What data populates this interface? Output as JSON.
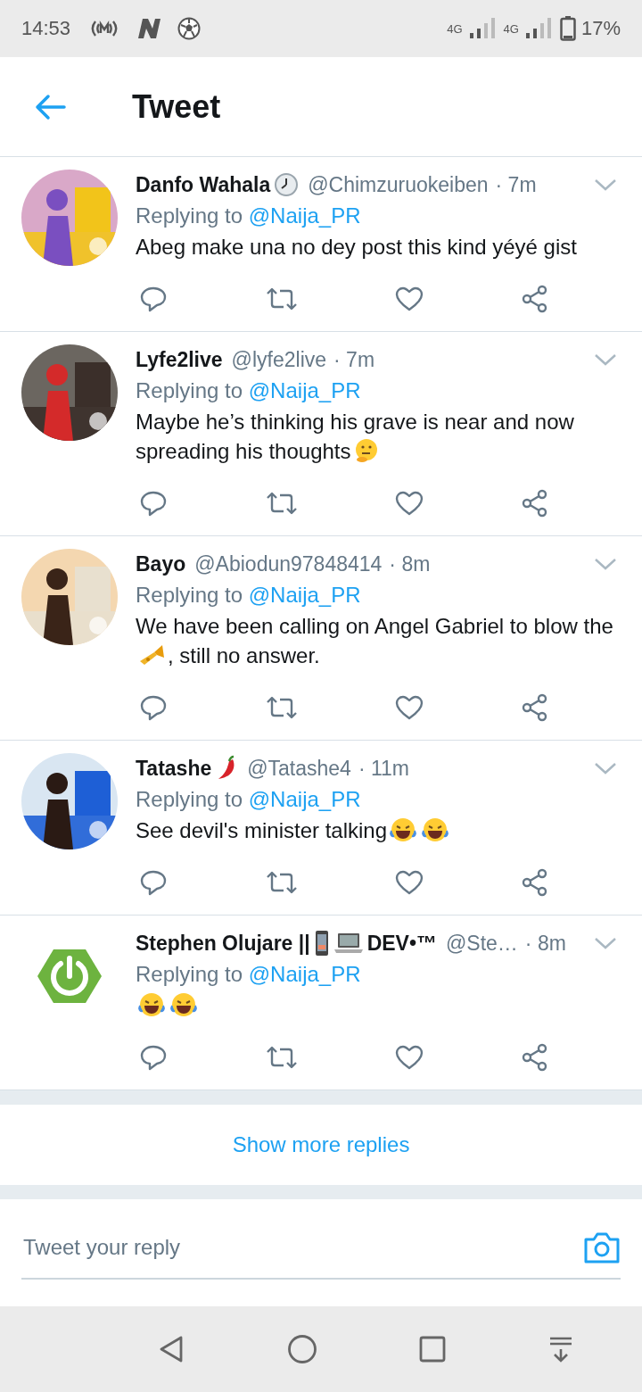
{
  "status_bar": {
    "time": "14:53",
    "network_1": "4G",
    "network_2": "4G",
    "battery": "17%"
  },
  "header": {
    "title": "Tweet"
  },
  "tweets": [
    {
      "avatar": {
        "kind": "picture"
      },
      "name": [
        {
          "kind": "text",
          "text": "Danfo Wahala"
        },
        {
          "kind": "clock"
        }
      ],
      "handle": "@Chimzuruokeiben",
      "time": "· 7m",
      "replying_label": "Replying to",
      "replying_to": "@Naija_PR",
      "body": [
        {
          "kind": "text",
          "text": "Abeg make una no dey post this kind yéyé gist"
        }
      ]
    },
    {
      "avatar": {
        "kind": "picture"
      },
      "name": [
        {
          "kind": "text",
          "text": "Lyfe2live"
        }
      ],
      "handle": "@lyfe2live",
      "time": "· 7m",
      "replying_label": "Replying to",
      "replying_to": "@Naija_PR",
      "body": [
        {
          "kind": "text",
          "text": "Maybe he’s thinking his grave is near and now spreading his thoughts"
        },
        {
          "kind": "thinking"
        }
      ]
    },
    {
      "avatar": {
        "kind": "picture"
      },
      "name": [
        {
          "kind": "text",
          "text": "Bayo"
        }
      ],
      "handle": "@Abiodun97848414",
      "time": "· 8m",
      "replying_label": "Replying to",
      "replying_to": "@Naija_PR",
      "body": [
        {
          "kind": "text",
          "text": "We have been calling on Angel Gabriel to blow the"
        },
        {
          "kind": "trumpet"
        },
        {
          "kind": "text",
          "text": ", still no answer."
        }
      ]
    },
    {
      "avatar": {
        "kind": "picture"
      },
      "name": [
        {
          "kind": "text",
          "text": "Tatashe"
        },
        {
          "kind": "chili"
        }
      ],
      "handle": "@Tatashe4",
      "time": "· 11m",
      "replying_label": "Replying to",
      "replying_to": "@Naija_PR",
      "body": [
        {
          "kind": "text",
          "text": "See devil's minister talking"
        },
        {
          "kind": "laugh"
        },
        {
          "kind": "laugh"
        }
      ]
    },
    {
      "avatar": {
        "kind": "logo"
      },
      "name": [
        {
          "kind": "text",
          "text": "Stephen Olujare ||"
        },
        {
          "kind": "phone"
        },
        {
          "kind": "laptop"
        },
        {
          "kind": "text",
          "text": "DEV•™"
        }
      ],
      "handle": "@Ste…",
      "time": "· 8m",
      "replying_label": "Replying to",
      "replying_to": "@Naija_PR",
      "body": [
        {
          "kind": "laugh"
        },
        {
          "kind": "laugh"
        }
      ]
    }
  ],
  "show_more": "Show more replies",
  "reply_box": {
    "placeholder": "Tweet your reply"
  }
}
